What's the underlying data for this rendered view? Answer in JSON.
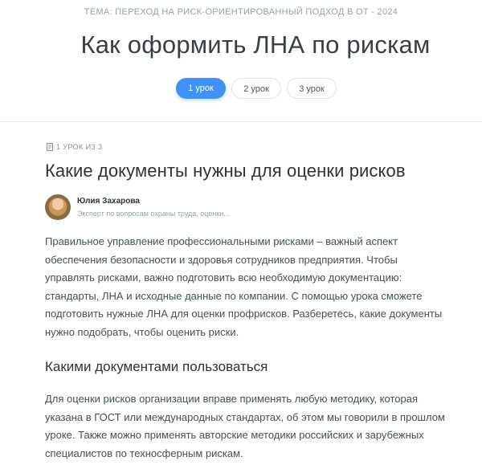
{
  "header": {
    "topic": "Тема: Переход на риск-ориентированный подход в ОТ - 2024",
    "course_title": "Как оформить ЛНА по рискам"
  },
  "tabs": [
    {
      "label": "1 урок",
      "active": true
    },
    {
      "label": "2 урок",
      "active": false
    },
    {
      "label": "3 урок",
      "active": false
    }
  ],
  "lesson": {
    "counter": "1 урок из 3",
    "title": "Какие документы нужны для оценки рисков",
    "author": {
      "name": "Юлия Захарова",
      "role": "Эксперт по вопросам охраны труда, оценки..."
    },
    "intro_lines": [
      "Правильное управление профессиональными рисками – важный аспект",
      "обеспечения безопасности и здоровья сотрудников предприятия. Чтобы",
      "управлять рисками, важно подготовить всю необходимую документацию:",
      "стандарты, ЛНА и исходные данные по компании. С помощью урока сможете",
      "подготовить нужные ЛНА для оценки профрисков. Разберетесь, какие документы",
      "нужно подобрать, чтобы оценить риски."
    ],
    "section_title": "Какими документами пользоваться",
    "section_lines": [
      "Для оценки рисков организации вправе применять любую методику, которая",
      "указана в ГОСТ или международных стандартах, об этом мы говорили в прошлом",
      "уроке. Также можно применять авторские методики российских и зарубежных",
      "специалистов по техносферным рискам."
    ]
  },
  "colors": {
    "accent": "#3f91f6",
    "text": "#4a4f55",
    "muted": "#9aa1a8"
  }
}
